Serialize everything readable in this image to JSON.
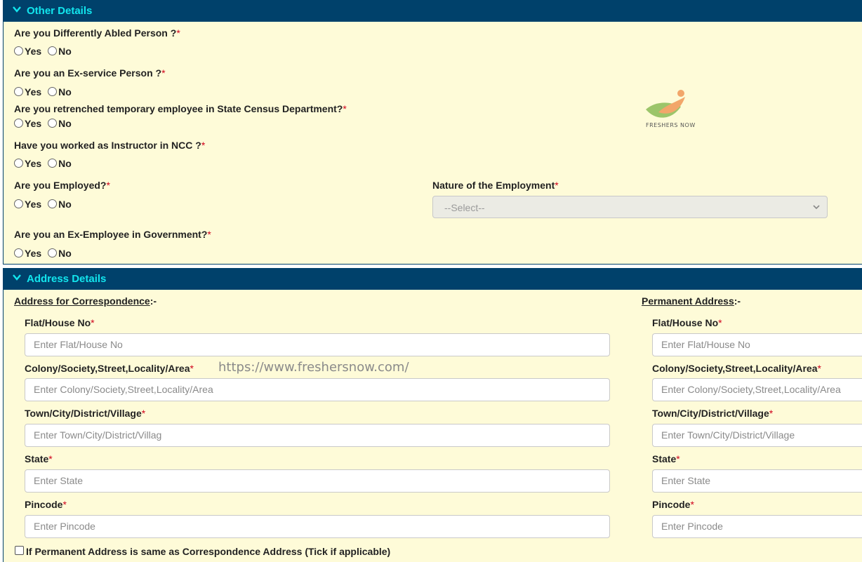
{
  "other": {
    "title": "Other Details",
    "q_disabled": "Are you Differently Abled Person ?",
    "q_exservice": "Are you an Ex-service Person ?",
    "q_census": "Are you retrenched temporary employee in State Census Department?",
    "q_ncc": "Have you worked as Instructor in NCC ?",
    "q_employed": "Are you Employed?",
    "q_nature": "Nature of the Employment",
    "nature_select": "--Select--",
    "q_exemployee": "Are you an Ex-Employee in Government?",
    "yes": "Yes",
    "no": "No",
    "req": "*"
  },
  "logo": {
    "text": "FRESHERS NOW"
  },
  "address": {
    "title": "Address Details",
    "corr_heading": "Address for Correspondence",
    "perm_heading": "Permanent Address",
    "heading_suffix": ":-",
    "watermark": "https://www.freshersnow.com/",
    "corr": {
      "flat_label": "Flat/House No",
      "flat_ph": "Enter Flat/House No",
      "colony_label": "Colony/Society,Street,Locality/Area",
      "colony_ph": "Enter Colony/Society,Street,Locality/Area",
      "town_label": "Town/City/District/Village",
      "town_ph": "Enter Town/City/District/Villag",
      "state_label": "State",
      "state_ph": "Enter State",
      "pin_label": "Pincode",
      "pin_ph": "Enter Pincode"
    },
    "perm": {
      "flat_label": "Flat/House No",
      "flat_ph": "Enter Flat/House No",
      "colony_label": "Colony/Society,Street,Locality/Area",
      "colony_ph": "Enter Colony/Society,Street,Locality/Area",
      "town_label": "Town/City/District/Village",
      "town_ph": "Enter Town/City/District/Village",
      "state_label": "State",
      "state_ph": "Enter State",
      "pin_label": "Pincode",
      "pin_ph": "Enter Pincode"
    },
    "same_checkbox": "If Permanent Address is same as Correspondence Address (Tick if applicable)"
  },
  "colors": {
    "header_bg": "#00416b",
    "header_text": "#12e6ee",
    "panel_bg": "#fefbd8",
    "required": "#d0021b"
  },
  "icons": {
    "collapse": "chevron-down-icon",
    "select_arrow": "chevron-down-icon"
  }
}
